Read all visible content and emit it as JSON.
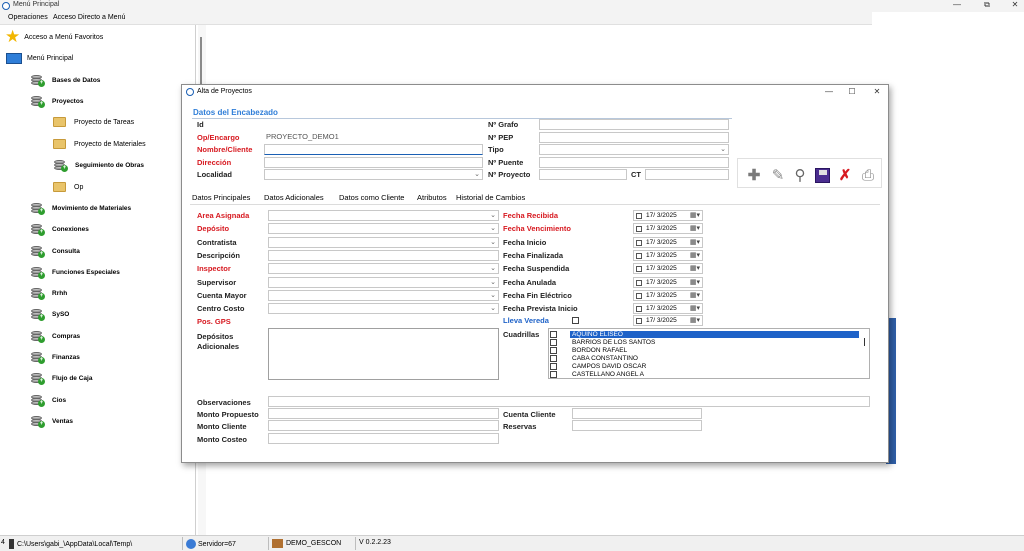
{
  "window": {
    "title": "Menú Principal",
    "menu": [
      "Operaciones",
      "Acceso Directo a Menú"
    ]
  },
  "tree": {
    "favorites": "Acceso a Menú Favoritos",
    "root": "Menú Principal",
    "items": [
      {
        "label": "Bases de Datos",
        "type": "db"
      },
      {
        "label": "Proyectos",
        "type": "db"
      },
      {
        "label": "Proyecto de Tareas",
        "type": "folder"
      },
      {
        "label": "Proyecto de Materiales",
        "type": "folder"
      },
      {
        "label": "Seguimiento de Obras",
        "type": "db"
      },
      {
        "label": "Op",
        "type": "folder"
      },
      {
        "label": "Movimiento de Materiales",
        "type": "db"
      },
      {
        "label": "Conexiones",
        "type": "db"
      },
      {
        "label": "Consulta",
        "type": "db"
      },
      {
        "label": "Funciones Especiales",
        "type": "db"
      },
      {
        "label": "Rrhh",
        "type": "db"
      },
      {
        "label": "SySO",
        "type": "db"
      },
      {
        "label": "Compras",
        "type": "db"
      },
      {
        "label": "Finanzas",
        "type": "db"
      },
      {
        "label": "Flujo de Caja",
        "type": "db"
      },
      {
        "label": "Cios",
        "type": "db"
      },
      {
        "label": "Ventas",
        "type": "db"
      }
    ]
  },
  "status": {
    "path": "C:\\Users\\gabi_\\AppData\\Local\\Temp\\",
    "server": "Servidor=67",
    "db": "DEMO_GESCON",
    "version": "V 0.2.2.23",
    "left_glyph": "4"
  },
  "dialog": {
    "title": "Alta de Proyectos",
    "header_section": "Datos del Encabezado",
    "header_left": [
      {
        "label": "Id",
        "value": "",
        "style": "normal"
      },
      {
        "label": "Op/Encargo",
        "value": "PROYECTO_DEMO1",
        "style": "red"
      },
      {
        "label": "Nombre/Cliente",
        "value": "",
        "style": "red"
      },
      {
        "label": "Dirección",
        "value": "",
        "style": "red"
      },
      {
        "label": "Localidad",
        "value": "",
        "style": "normal"
      }
    ],
    "header_right": [
      {
        "label": "Nº Grafo",
        "value": ""
      },
      {
        "label": "Nº PEP",
        "value": ""
      },
      {
        "label": "Tipo",
        "value": ""
      },
      {
        "label": "Nº Puente",
        "value": ""
      },
      {
        "label": "Nº Proyecto",
        "value": ""
      }
    ],
    "ct_label": "CT",
    "tabs": [
      "Datos Principales",
      "Datos Adicionales",
      "Datos como Cliente",
      "Atributos",
      "Historial de Cambios"
    ],
    "main_left": [
      {
        "label": "Area Asignada",
        "style": "red"
      },
      {
        "label": "Depósito",
        "style": "red"
      },
      {
        "label": "Contratista",
        "style": "normal"
      },
      {
        "label": "Descripción",
        "style": "normal"
      },
      {
        "label": "Inspector",
        "style": "red"
      },
      {
        "label": "Supervisor",
        "style": "normal"
      },
      {
        "label": "Cuenta Mayor",
        "style": "normal"
      },
      {
        "label": "Centro Costo",
        "style": "normal"
      },
      {
        "label": "Pos. GPS",
        "style": "red"
      }
    ],
    "depositos_label": "Depósitos Adicionales",
    "dates": [
      {
        "label": "Fecha Recibida",
        "value": "17/ 3/2025",
        "style": "red"
      },
      {
        "label": "Fecha Vencimiento",
        "value": "17/ 3/2025",
        "style": "red"
      },
      {
        "label": "Fecha Inicio",
        "value": "17/ 3/2025",
        "style": "normal"
      },
      {
        "label": "Fecha Finalizada",
        "value": "17/ 3/2025",
        "style": "normal"
      },
      {
        "label": "Fecha Suspendida",
        "value": "17/ 3/2025",
        "style": "normal"
      },
      {
        "label": "Fecha Anulada",
        "value": "17/ 3/2025",
        "style": "normal"
      },
      {
        "label": "Fecha Fin Eléctrico",
        "value": "17/ 3/2025",
        "style": "normal"
      },
      {
        "label": "Fecha Prevista Inicio",
        "value": "17/ 3/2025",
        "style": "normal"
      }
    ],
    "lleva_vereda": {
      "label": "Lleva Vereda",
      "date": "17/ 3/2025"
    },
    "cuadrillas_label": "Cuadrillas",
    "cuadrillas": [
      "AQUINO ELISEO",
      "BARRIOS DE LOS SANTOS",
      "BORDON RAFAEL",
      "CABA CONSTANTINO",
      "CAMPOS DAVID OSCAR",
      "CASTELLANO ANGEL A"
    ],
    "bottom": {
      "observaciones": "Observaciones",
      "monto_propuesto": "Monto Propuesto",
      "monto_cliente": "Monto Cliente",
      "monto_costeo": "Monto Costeo",
      "cuenta_cliente": "Cuenta Cliente",
      "reservas": "Reservas"
    },
    "toolbar_icons": [
      "add-icon",
      "edit-icon",
      "search-icon",
      "save-icon",
      "delete-icon",
      "print-icon"
    ]
  }
}
